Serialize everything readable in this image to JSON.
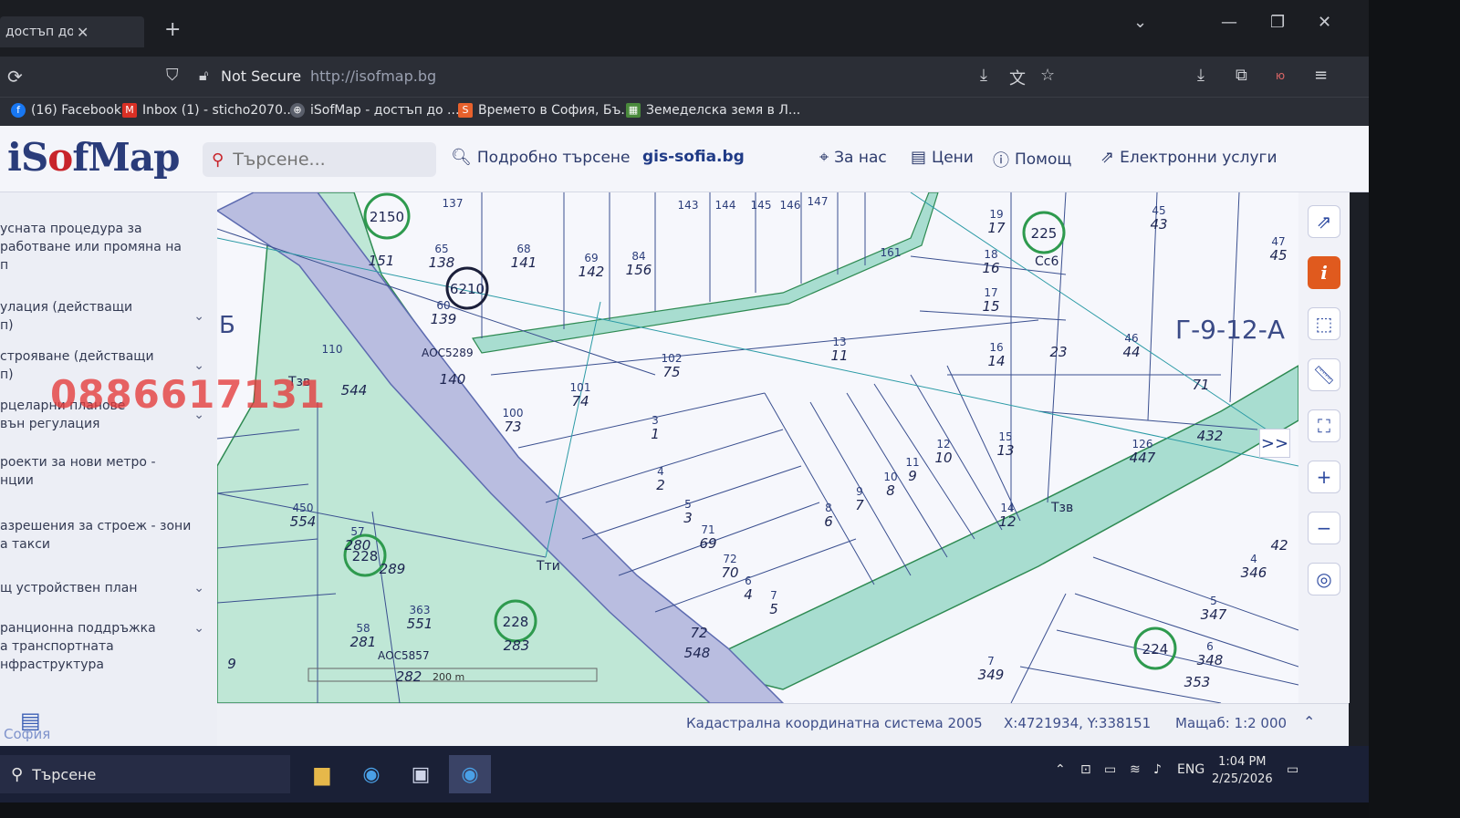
{
  "browser": {
    "tab_title": "достъп до цифрови",
    "tab_close": "✕",
    "new_tab": "+",
    "security_label": "Not Secure",
    "url": "http://isofmap.bg"
  },
  "bookmarks": [
    {
      "label": "(16) Facebook",
      "color": "#1877f2",
      "glyph": "f"
    },
    {
      "label": "Inbox (1) - sticho2070...",
      "color": "#d93025",
      "glyph": "M"
    },
    {
      "label": "iSofMap - достъп до ...",
      "color": "#5a5f6b",
      "glyph": "⊕"
    },
    {
      "label": "Времето в София, Бъ...",
      "color": "#e8612c",
      "glyph": "S"
    },
    {
      "label": "Земеделска земя в Л...",
      "color": "#4a8a3c",
      "glyph": "▦"
    }
  ],
  "site": {
    "logo_pre": "iS",
    "logo_o": "o",
    "logo_post": "fMap",
    "search_placeholder": "Търсене...",
    "advanced_search": "Подробно търсене",
    "gis_link": "gis-sofia.bg",
    "nav": {
      "about": "За нас",
      "prices": "Цени",
      "help": "Помощ",
      "services": "Електронни услуги"
    },
    "colors": {
      "brand_blue": "#2a3c7a",
      "brand_red": "#c8242b"
    }
  },
  "sidebar": {
    "items": [
      {
        "label": "усната процедура за\nработване или промяна на\nп",
        "expandable": false
      },
      {
        "label": "улация (действащи\nп)",
        "expandable": true
      },
      {
        "label": "строяване (действащи\nп)",
        "expandable": true
      },
      {
        "label": "рцеларни планове\nвън регулация",
        "expandable": true
      },
      {
        "label": "роекти за нови метро -\nнции",
        "expandable": false
      },
      {
        "label": "азрешения за строеж - зони\nа такси",
        "expandable": false
      },
      {
        "label": "щ устройствен план",
        "expandable": true
      },
      {
        "label": "ранционна поддръжка\nа транспортната\nнфраструктура",
        "expandable": true
      }
    ],
    "overlay_phone": "0886617131",
    "sofia_label": "София"
  },
  "map": {
    "sheet_label": "Г-9-12-А",
    "left_sheet_label": "Б",
    "scale_bar": "200 m",
    "labels": [
      {
        "a": "137",
        "b": ""
      },
      {
        "a": "65",
        "b": "138"
      },
      {
        "a": "68",
        "b": "141"
      },
      {
        "a": "69",
        "b": "142"
      },
      {
        "a": "84",
        "b": "156"
      },
      {
        "a": "143",
        "b": ""
      },
      {
        "a": "144",
        "b": ""
      },
      {
        "a": "145",
        "b": ""
      },
      {
        "a": "146",
        "b": ""
      },
      {
        "a": "147",
        "b": ""
      },
      {
        "a": "161",
        "b": ""
      },
      {
        "a": "19",
        "b": "17"
      },
      {
        "a": "18",
        "b": "16"
      },
      {
        "a": "17",
        "b": "15"
      },
      {
        "a": "45",
        "b": "43"
      },
      {
        "a": "47",
        "b": "45"
      },
      {
        "a": "13",
        "b": "11"
      },
      {
        "a": "16",
        "b": "14"
      },
      {
        "a": "46",
        "b": "44"
      },
      {
        "a": "102",
        "b": "75"
      },
      {
        "a": "101",
        "b": "74"
      },
      {
        "a": "100",
        "b": "73"
      },
      {
        "a": "3",
        "b": "1"
      },
      {
        "a": "4",
        "b": "2"
      },
      {
        "a": "5",
        "b": "3"
      },
      {
        "a": "71",
        "b": "69"
      },
      {
        "a": "72",
        "b": "70"
      },
      {
        "a": "6",
        "b": "4"
      },
      {
        "a": "7",
        "b": "5"
      },
      {
        "a": "8",
        "b": "6"
      },
      {
        "a": "9",
        "b": "7"
      },
      {
        "a": "10",
        "b": "8"
      },
      {
        "a": "11",
        "b": "9"
      },
      {
        "a": "12",
        "b": "10"
      },
      {
        "a": "15",
        "b": "13"
      },
      {
        "a": "14",
        "b": "12"
      },
      {
        "a": "126",
        "b": "447"
      },
      {
        "a": "",
        "b": "432"
      },
      {
        "a": "",
        "b": "71"
      },
      {
        "a": "4",
        "b": "346"
      },
      {
        "a": "5",
        "b": "347"
      },
      {
        "a": "6",
        "b": "348"
      },
      {
        "a": "",
        "b": "353"
      },
      {
        "a": "7",
        "b": "349"
      },
      {
        "a": "",
        "b": "42"
      },
      {
        "a": "110",
        "b": ""
      },
      {
        "a": "",
        "b": "544"
      },
      {
        "a": "60",
        "b": "139"
      },
      {
        "a": "",
        "b": "140"
      },
      {
        "a": "450",
        "b": "554"
      },
      {
        "a": "57",
        "b": "280"
      },
      {
        "a": "",
        "b": "289"
      },
      {
        "a": "363",
        "b": "551"
      },
      {
        "a": "58",
        "b": "281"
      },
      {
        "a": "",
        "b": "282"
      },
      {
        "a": "",
        "b": "283"
      },
      {
        "a": "",
        "b": "548"
      },
      {
        "a": "",
        "b": "72"
      },
      {
        "a": "",
        "b": "9"
      },
      {
        "a": "",
        "b": "151"
      },
      {
        "a": "",
        "b": "23"
      }
    ],
    "circles": [
      "2150",
      "6210",
      "225",
      "228",
      "228",
      "224"
    ],
    "text_labels": [
      "Тзв",
      "Тзв",
      "Тти",
      "Сс6",
      "АОС5289",
      "АОС5857"
    ]
  },
  "toolbar": {
    "buttons": [
      "external-link",
      "info",
      "select-area",
      "ruler",
      "fullscreen",
      "zoom-in",
      "zoom-out",
      "locate"
    ],
    "expand": ">>"
  },
  "status": {
    "crs": "Кадастрална координатна система 2005",
    "coords": "X:4721934, Y:338151",
    "scale": "Мащаб: 1:2 000"
  },
  "taskbar": {
    "search_label": "Търсене",
    "lang": "ENG",
    "time": "1:04 PM",
    "date": "2/25/2026"
  }
}
